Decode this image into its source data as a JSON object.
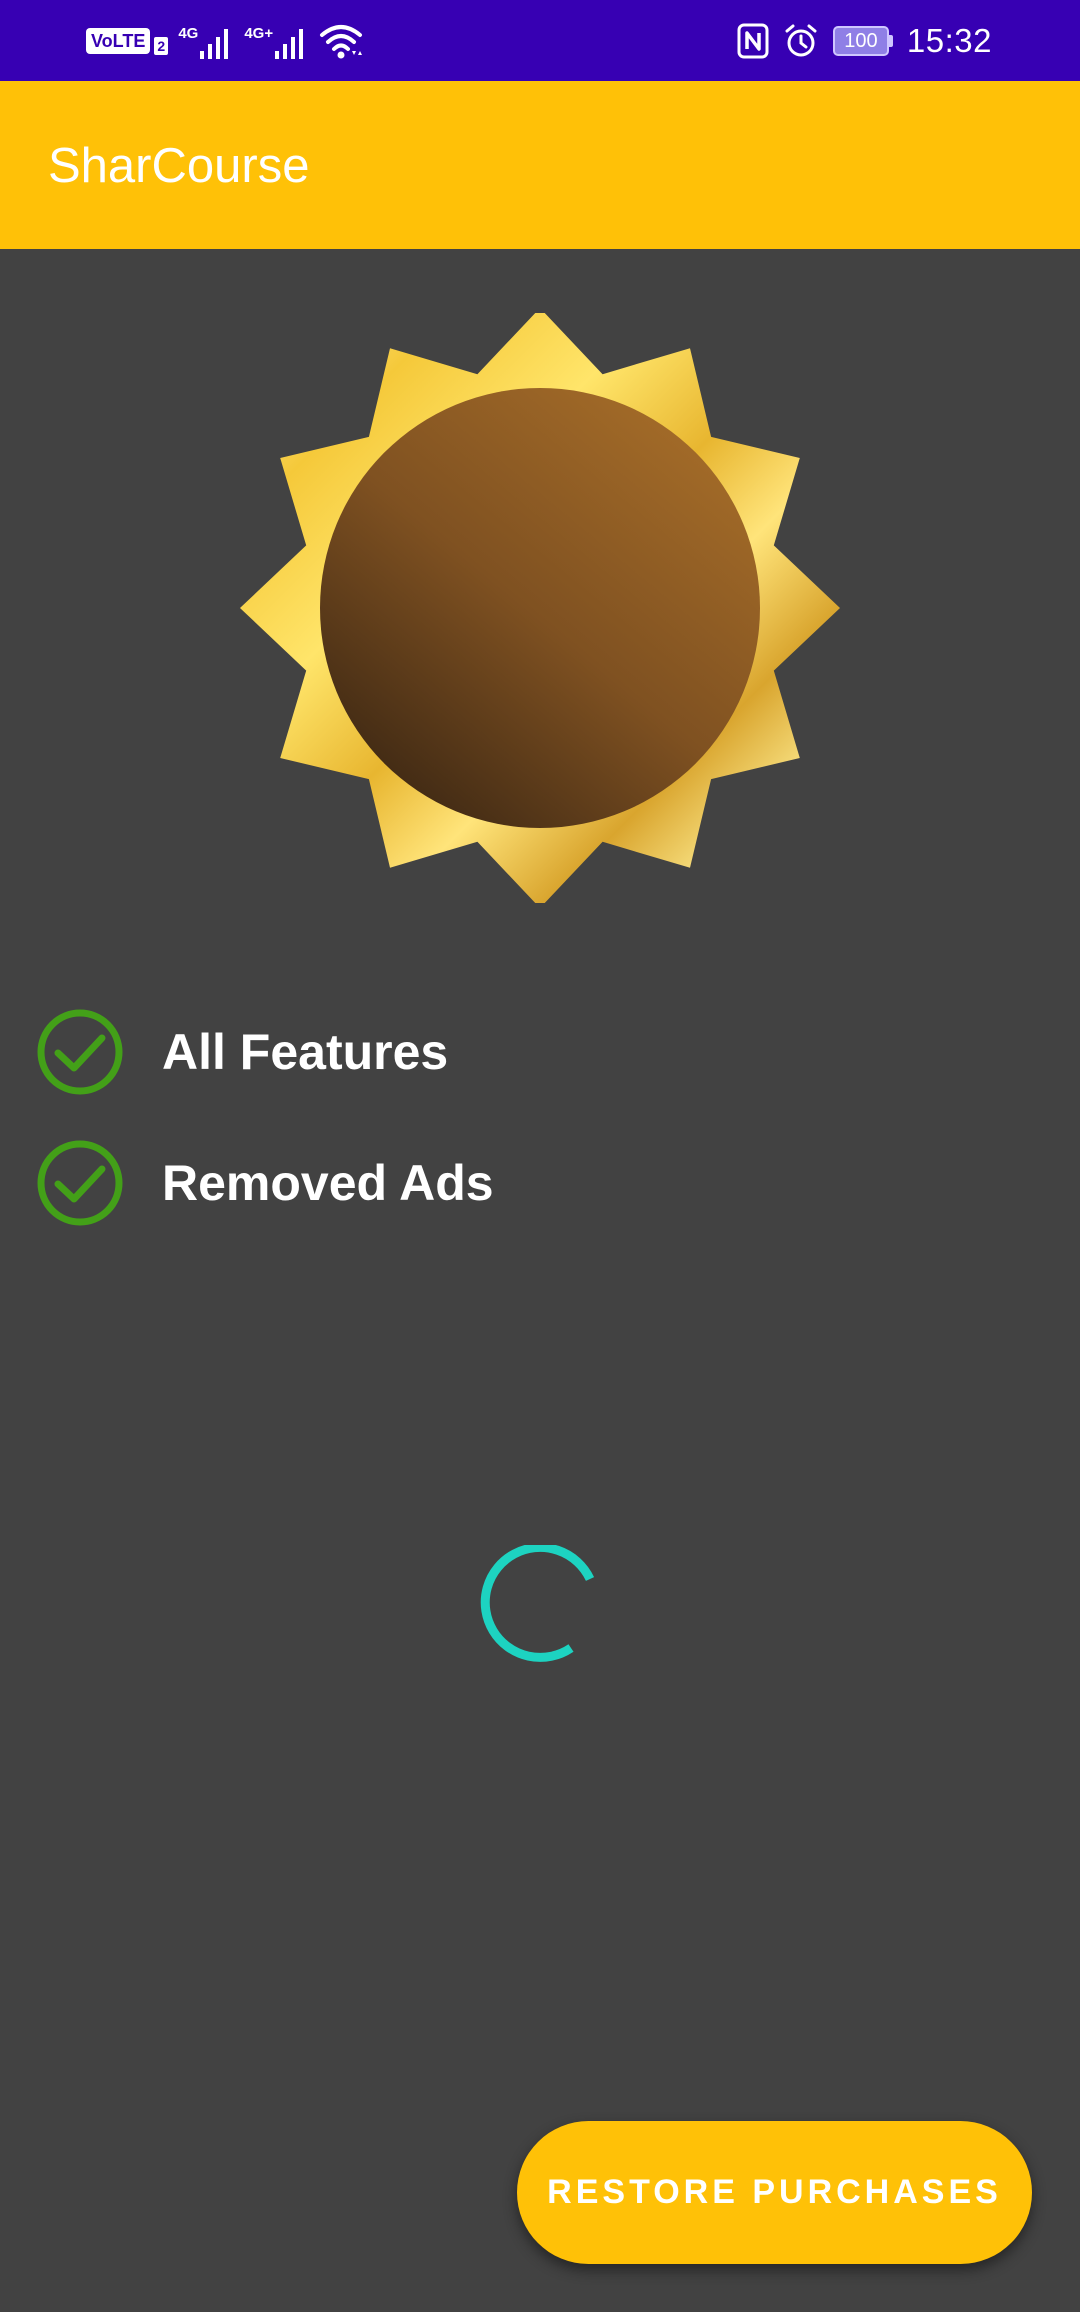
{
  "status_bar": {
    "volte": "VoLTE",
    "sim": "2",
    "net1": "4G",
    "net2": "4G+",
    "battery": "100",
    "time": "15:32",
    "icons": [
      "volte-icon",
      "signal-icon",
      "signal-icon",
      "wifi-icon",
      "nfc-icon",
      "alarm-icon",
      "battery-icon"
    ]
  },
  "app_bar": {
    "title": "SharCourse"
  },
  "badge": {
    "icon": "premium-badge-icon"
  },
  "features": [
    {
      "label": "All Features",
      "icon": "check-circle-icon"
    },
    {
      "label": "Removed Ads",
      "icon": "check-circle-icon"
    }
  ],
  "restore_button": {
    "label": "RESTORE PURCHASES"
  },
  "colors": {
    "status_bar": "#3700B3",
    "app_bar": "#FFC107",
    "background": "#424242",
    "check": "#43A018",
    "spinner": "#1DD3C1",
    "badge_gold": "#F7D14A",
    "badge_center": "#8B5A22"
  }
}
